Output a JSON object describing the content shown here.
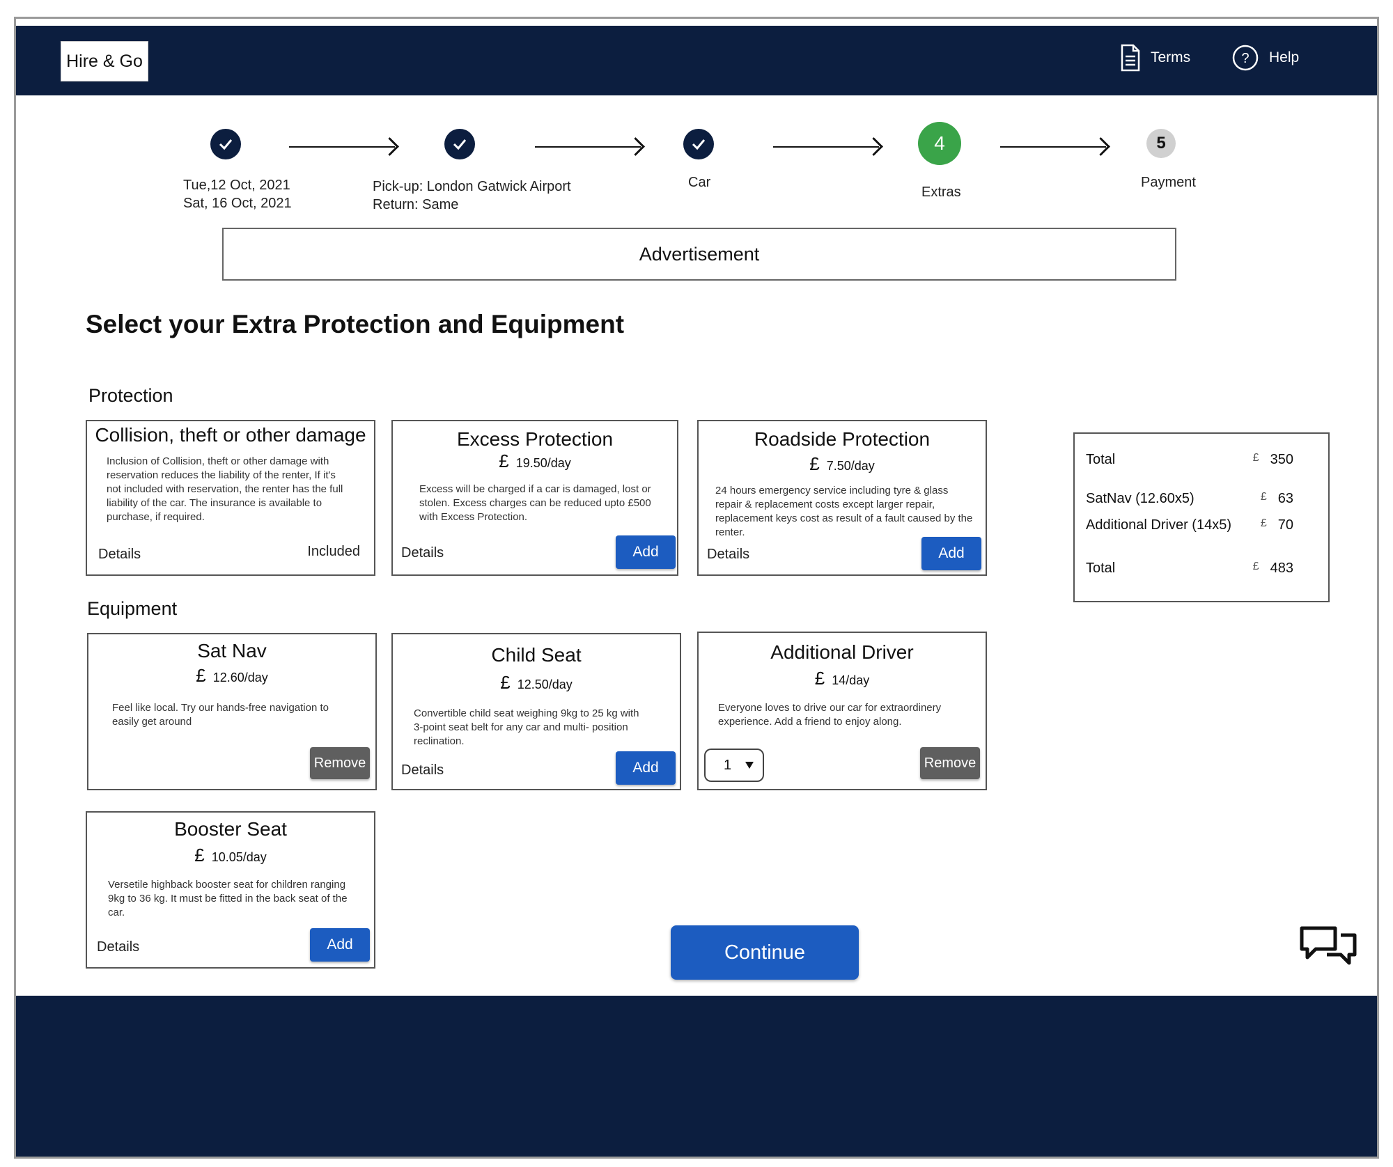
{
  "header": {
    "logo": "Hire & Go",
    "nav": {
      "terms": "Terms",
      "help": "Help"
    }
  },
  "steps": [
    {
      "status": "done",
      "label_lines": [
        "Tue,12 Oct, 2021",
        "Sat, 16 Oct, 2021"
      ]
    },
    {
      "status": "done",
      "label_lines": [
        "Pick-up: London Gatwick Airport",
        "Return: Same"
      ]
    },
    {
      "status": "done",
      "label_lines": [
        "Car"
      ]
    },
    {
      "status": "current",
      "number": "4",
      "label_lines": [
        "Extras"
      ]
    },
    {
      "status": "pending",
      "number": "5",
      "label_lines": [
        "Payment"
      ]
    }
  ],
  "advertisement": "Advertisement",
  "page_title": "Select your Extra Protection and Equipment",
  "protection": {
    "heading": "Protection",
    "cards": [
      {
        "title": "Collision, theft or other damage",
        "description": "Inclusion of Collision, theft or other damage with reservation reduces the liability of the renter, If it's not included with reservation, the renter has the full liability of the car. The insurance is available to purchase, if required.",
        "details": "Details",
        "status": "Included"
      },
      {
        "title": "Excess Protection",
        "currency": "£",
        "price": "19.50/day",
        "description": "Excess will be charged if a car is damaged, lost or stolen. Excess charges can be reduced upto £500 with Excess Protection.",
        "details": "Details",
        "action": "Add"
      },
      {
        "title": "Roadside Protection",
        "currency": "£",
        "price": "7.50/day",
        "description": "24 hours emergency service including tyre & glass repair & replacement costs except larger repair, replacement keys cost as result of a fault caused by the renter.",
        "details": "Details",
        "action": "Add"
      }
    ]
  },
  "equipment": {
    "heading": "Equipment",
    "cards": [
      {
        "title": "Sat Nav",
        "currency": "£",
        "price": "12.60/day",
        "description": "Feel like local. Try our hands-free navigation to easily get around",
        "action": "Remove"
      },
      {
        "title": "Child Seat",
        "currency": "£",
        "price": "12.50/day",
        "description": "Convertible child seat weighing 9kg to 25 kg with 3-point seat belt for any car and multi- position reclination.",
        "details": "Details",
        "action": "Add"
      },
      {
        "title": "Additional Driver",
        "currency": "£",
        "price": "14/day",
        "description": "Everyone loves to drive our car for extraordinery experience. Add a friend to enjoy along.",
        "quantity": "1",
        "action": "Remove"
      },
      {
        "title": "Booster Seat",
        "currency": "£",
        "price": "10.05/day",
        "description": "Versetile highback booster seat for children ranging 9kg to 36 kg. It must be fitted in the back seat of the car.",
        "details": "Details",
        "action": "Add"
      }
    ]
  },
  "summary": {
    "currency": "£",
    "rows": [
      {
        "label": "Total",
        "amount": "350"
      },
      {
        "label": "SatNav (12.60x5)",
        "amount": "63"
      },
      {
        "label": "Additional Driver (14x5)",
        "amount": "70"
      },
      {
        "label": "Total",
        "amount": "483"
      }
    ]
  },
  "continue_label": "Continue",
  "colors": {
    "navy": "#0c1e3f",
    "primary_button": "#1c5cc0",
    "current_step": "#3aa449",
    "remove_button": "#5f5f5f"
  }
}
